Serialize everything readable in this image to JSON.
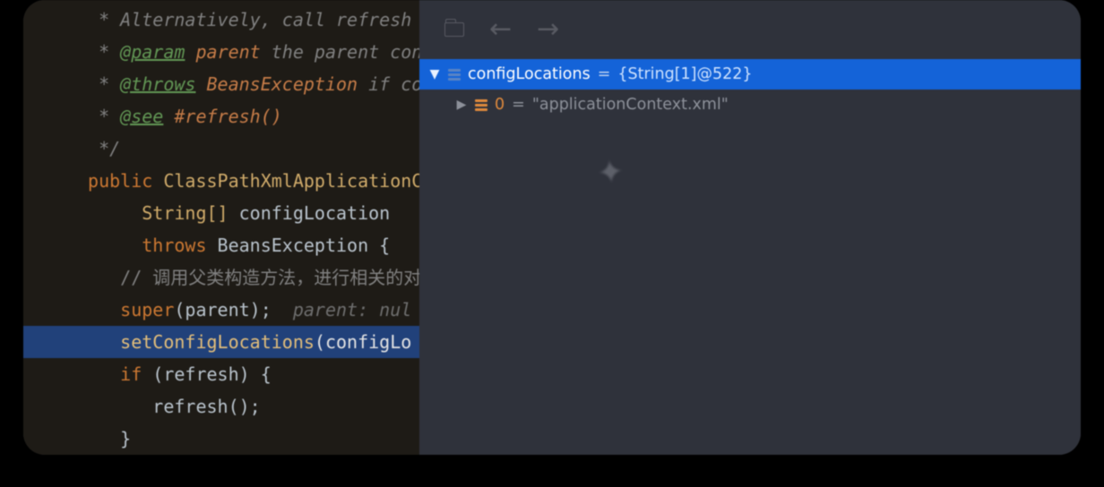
{
  "editor": {
    "lines": {
      "l0": "* Alternatively, call refresh",
      "l1_tag": "@param",
      "l1_name": "parent",
      "l1_rest": " the parent con",
      "l2_tag": "@throws",
      "l2_name": "BeansException",
      "l2_rest": " if co",
      "l3_tag": "@see",
      "l3_ref": "#refresh()",
      "l4": "*/",
      "l5_kw": "public",
      "l5_type": "ClassPathXmlApplicationC",
      "l6_type": "String[]",
      "l6_name": "configLocation",
      "l7_kw": "throws",
      "l7_type": "BeansException",
      "l7_brace": " {",
      "l8": "// 调用父类构造方法，进行相关的对",
      "l9_call": "super",
      "l9_arg": "(parent);",
      "l9_hint": "  parent: nul",
      "l10_call": "setConfigLocations",
      "l10_arg": "(configLo",
      "l11_kw": "if",
      "l11_rest": " (refresh) {",
      "l12": "refresh();",
      "l13": "}"
    }
  },
  "debugger": {
    "selected": {
      "name": "configLocations",
      "op": "=",
      "value": "{String[1]@522}"
    },
    "child": {
      "index": "0",
      "op": "=",
      "value": "\"applicationContext.xml\""
    }
  }
}
